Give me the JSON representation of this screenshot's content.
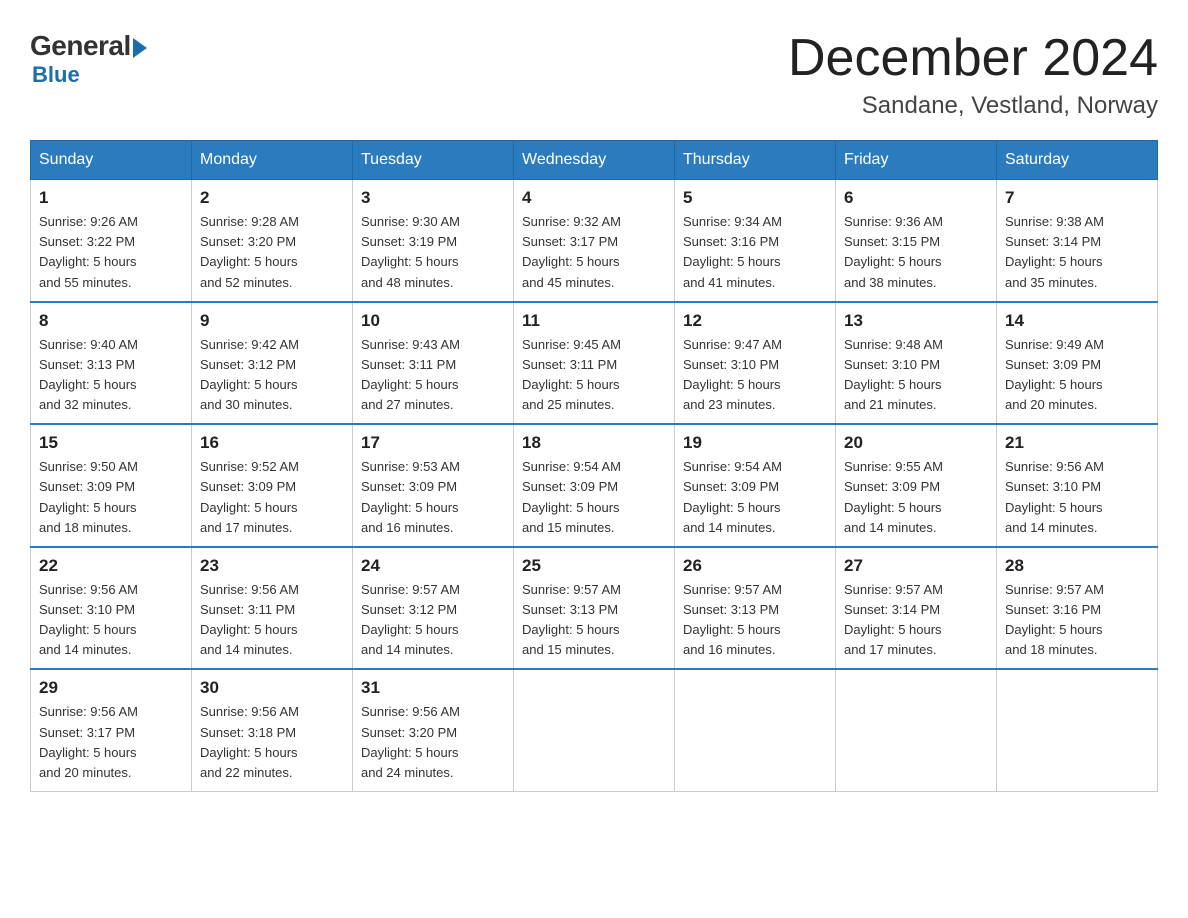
{
  "header": {
    "logo_general": "General",
    "logo_blue": "Blue",
    "month_title": "December 2024",
    "location": "Sandane, Vestland, Norway"
  },
  "days_of_week": [
    "Sunday",
    "Monday",
    "Tuesday",
    "Wednesday",
    "Thursday",
    "Friday",
    "Saturday"
  ],
  "weeks": [
    [
      {
        "day": "1",
        "sunrise": "9:26 AM",
        "sunset": "3:22 PM",
        "daylight": "5 hours and 55 minutes."
      },
      {
        "day": "2",
        "sunrise": "9:28 AM",
        "sunset": "3:20 PM",
        "daylight": "5 hours and 52 minutes."
      },
      {
        "day": "3",
        "sunrise": "9:30 AM",
        "sunset": "3:19 PM",
        "daylight": "5 hours and 48 minutes."
      },
      {
        "day": "4",
        "sunrise": "9:32 AM",
        "sunset": "3:17 PM",
        "daylight": "5 hours and 45 minutes."
      },
      {
        "day": "5",
        "sunrise": "9:34 AM",
        "sunset": "3:16 PM",
        "daylight": "5 hours and 41 minutes."
      },
      {
        "day": "6",
        "sunrise": "9:36 AM",
        "sunset": "3:15 PM",
        "daylight": "5 hours and 38 minutes."
      },
      {
        "day": "7",
        "sunrise": "9:38 AM",
        "sunset": "3:14 PM",
        "daylight": "5 hours and 35 minutes."
      }
    ],
    [
      {
        "day": "8",
        "sunrise": "9:40 AM",
        "sunset": "3:13 PM",
        "daylight": "5 hours and 32 minutes."
      },
      {
        "day": "9",
        "sunrise": "9:42 AM",
        "sunset": "3:12 PM",
        "daylight": "5 hours and 30 minutes."
      },
      {
        "day": "10",
        "sunrise": "9:43 AM",
        "sunset": "3:11 PM",
        "daylight": "5 hours and 27 minutes."
      },
      {
        "day": "11",
        "sunrise": "9:45 AM",
        "sunset": "3:11 PM",
        "daylight": "5 hours and 25 minutes."
      },
      {
        "day": "12",
        "sunrise": "9:47 AM",
        "sunset": "3:10 PM",
        "daylight": "5 hours and 23 minutes."
      },
      {
        "day": "13",
        "sunrise": "9:48 AM",
        "sunset": "3:10 PM",
        "daylight": "5 hours and 21 minutes."
      },
      {
        "day": "14",
        "sunrise": "9:49 AM",
        "sunset": "3:09 PM",
        "daylight": "5 hours and 20 minutes."
      }
    ],
    [
      {
        "day": "15",
        "sunrise": "9:50 AM",
        "sunset": "3:09 PM",
        "daylight": "5 hours and 18 minutes."
      },
      {
        "day": "16",
        "sunrise": "9:52 AM",
        "sunset": "3:09 PM",
        "daylight": "5 hours and 17 minutes."
      },
      {
        "day": "17",
        "sunrise": "9:53 AM",
        "sunset": "3:09 PM",
        "daylight": "5 hours and 16 minutes."
      },
      {
        "day": "18",
        "sunrise": "9:54 AM",
        "sunset": "3:09 PM",
        "daylight": "5 hours and 15 minutes."
      },
      {
        "day": "19",
        "sunrise": "9:54 AM",
        "sunset": "3:09 PM",
        "daylight": "5 hours and 14 minutes."
      },
      {
        "day": "20",
        "sunrise": "9:55 AM",
        "sunset": "3:09 PM",
        "daylight": "5 hours and 14 minutes."
      },
      {
        "day": "21",
        "sunrise": "9:56 AM",
        "sunset": "3:10 PM",
        "daylight": "5 hours and 14 minutes."
      }
    ],
    [
      {
        "day": "22",
        "sunrise": "9:56 AM",
        "sunset": "3:10 PM",
        "daylight": "5 hours and 14 minutes."
      },
      {
        "day": "23",
        "sunrise": "9:56 AM",
        "sunset": "3:11 PM",
        "daylight": "5 hours and 14 minutes."
      },
      {
        "day": "24",
        "sunrise": "9:57 AM",
        "sunset": "3:12 PM",
        "daylight": "5 hours and 14 minutes."
      },
      {
        "day": "25",
        "sunrise": "9:57 AM",
        "sunset": "3:13 PM",
        "daylight": "5 hours and 15 minutes."
      },
      {
        "day": "26",
        "sunrise": "9:57 AM",
        "sunset": "3:13 PM",
        "daylight": "5 hours and 16 minutes."
      },
      {
        "day": "27",
        "sunrise": "9:57 AM",
        "sunset": "3:14 PM",
        "daylight": "5 hours and 17 minutes."
      },
      {
        "day": "28",
        "sunrise": "9:57 AM",
        "sunset": "3:16 PM",
        "daylight": "5 hours and 18 minutes."
      }
    ],
    [
      {
        "day": "29",
        "sunrise": "9:56 AM",
        "sunset": "3:17 PM",
        "daylight": "5 hours and 20 minutes."
      },
      {
        "day": "30",
        "sunrise": "9:56 AM",
        "sunset": "3:18 PM",
        "daylight": "5 hours and 22 minutes."
      },
      {
        "day": "31",
        "sunrise": "9:56 AM",
        "sunset": "3:20 PM",
        "daylight": "5 hours and 24 minutes."
      },
      null,
      null,
      null,
      null
    ]
  ],
  "labels": {
    "sunrise_prefix": "Sunrise: ",
    "sunset_prefix": "Sunset: ",
    "daylight_prefix": "Daylight: "
  }
}
